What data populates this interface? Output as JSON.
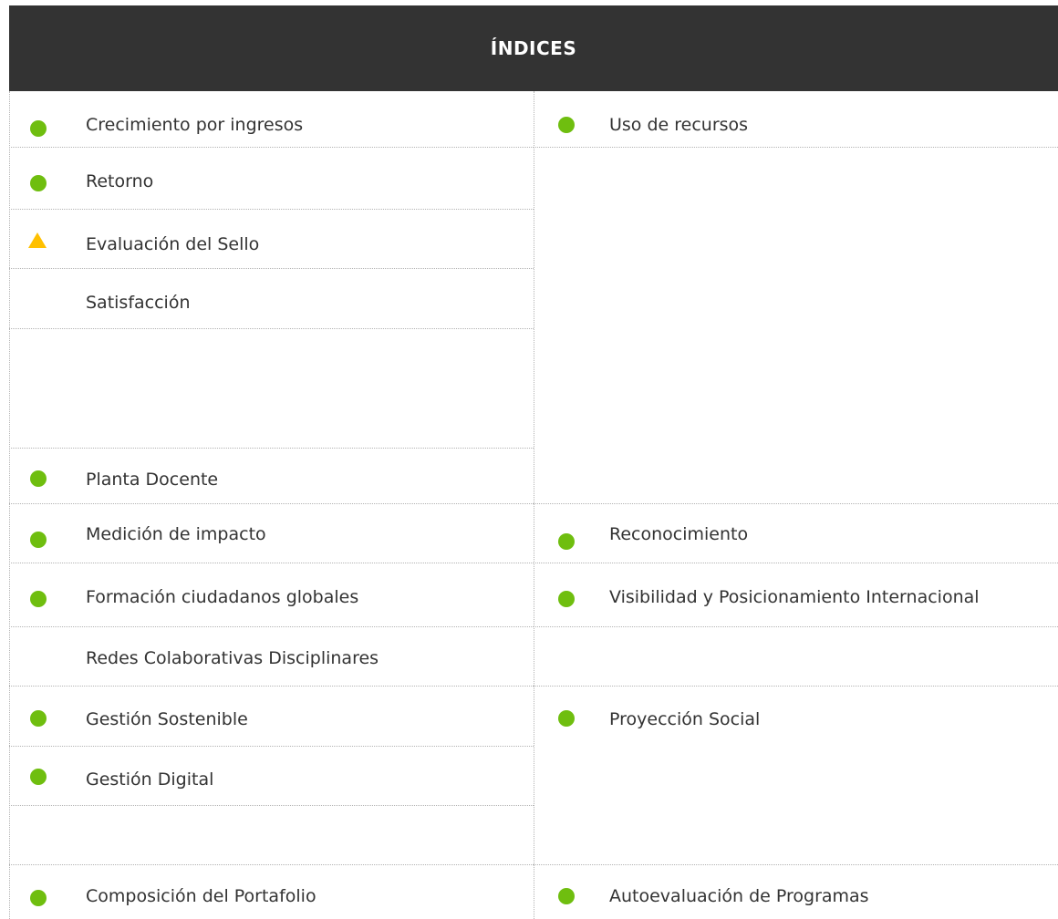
{
  "header": {
    "title": "ÍNDICES"
  },
  "colors": {
    "good": "#6fbe0f",
    "warning": "#ffc000",
    "header_bg": "#333333"
  },
  "left_column": [
    {
      "label": "Crecimiento por ingresos",
      "status": "green-dot"
    },
    {
      "label": "Retorno",
      "status": "green-dot"
    },
    {
      "label": "Evaluación del Sello",
      "status": "yellow-triangle"
    },
    {
      "label": "Satisfacción",
      "status": "none"
    },
    {
      "label": "",
      "status": "none"
    },
    {
      "label": "Planta Docente",
      "status": "green-dot"
    },
    {
      "label": "Medición de impacto",
      "status": "green-dot"
    },
    {
      "label": "Formación ciudadanos globales",
      "status": "green-dot"
    },
    {
      "label": "Redes Colaborativas Disciplinares",
      "status": "none"
    },
    {
      "label": "Gestión Sostenible",
      "status": "green-dot"
    },
    {
      "label": "Gestión Digital",
      "status": "green-dot"
    },
    {
      "label": "",
      "status": "none"
    },
    {
      "label": "Composición del Portafolio",
      "status": "green-dot"
    }
  ],
  "right_column": [
    {
      "label": "Uso de recursos",
      "status": "green-dot"
    },
    {
      "label": "",
      "status": "none"
    },
    {
      "label": "Reconocimiento",
      "status": "green-dot"
    },
    {
      "label": "Visibilidad y Posicionamiento Internacional",
      "status": "green-dot"
    },
    {
      "label": "",
      "status": "none"
    },
    {
      "label": "Proyección Social",
      "status": "green-dot"
    },
    {
      "label": "",
      "status": "none"
    },
    {
      "label": "Autoevaluación de Programas",
      "status": "green-dot"
    }
  ]
}
